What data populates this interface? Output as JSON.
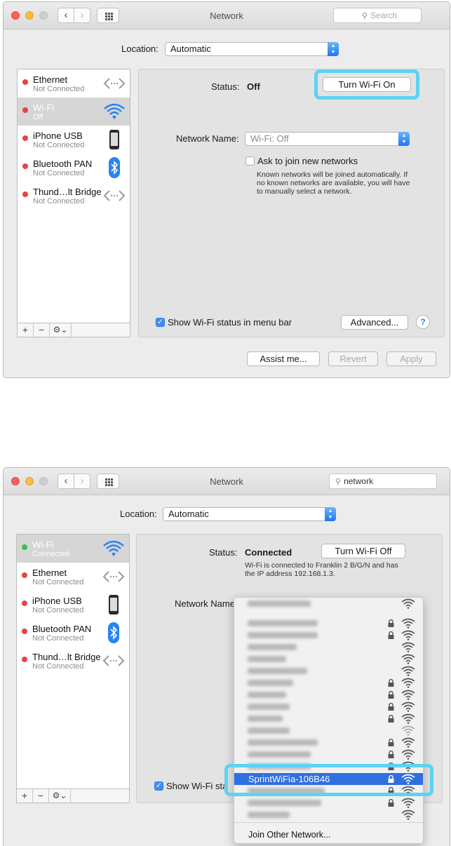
{
  "colors": {
    "accent": "#2f6fe0",
    "highlight": "#5dd3f3",
    "status_red": "#e2463f",
    "status_green": "#34c24b"
  },
  "window1": {
    "title": "Network",
    "search_placeholder": "Search",
    "location_label": "Location:",
    "location_value": "Automatic",
    "sidebar": [
      {
        "name": "Ethernet",
        "status": "Not Connected",
        "icon": "ethernet-icon",
        "dot": "red"
      },
      {
        "name": "Wi-Fi",
        "status": "Off",
        "icon": "wifi-icon",
        "dot": "red",
        "selected": true
      },
      {
        "name": "iPhone USB",
        "status": "Not Connected",
        "icon": "iphone-icon",
        "dot": "red"
      },
      {
        "name": "Bluetooth PAN",
        "status": "Not Connected",
        "icon": "bluetooth-icon",
        "dot": "red"
      },
      {
        "name": "Thund…lt Bridge",
        "status": "Not Connected",
        "icon": "thunderbolt-bridge-icon",
        "dot": "red"
      }
    ],
    "sidebar_footer": {
      "add": "+",
      "remove": "−",
      "gear": "⚙︎⌄"
    },
    "status_label": "Status:",
    "status_value": "Off",
    "turn_button": "Turn Wi-Fi On",
    "network_name_label": "Network Name:",
    "network_name_value": "Wi-Fi: Off",
    "ask_join_label": "Ask to join new networks",
    "ask_join_desc": "Known networks will be joined automatically. If no known networks are available, you will have to manually select a network.",
    "show_status_label": "Show Wi-Fi status in menu bar",
    "advanced_button": "Advanced...",
    "help": "?",
    "assist_button": "Assist me...",
    "revert_button": "Revert",
    "apply_button": "Apply"
  },
  "window2": {
    "title": "Network",
    "search_value": "network",
    "location_label": "Location:",
    "location_value": "Automatic",
    "sidebar": [
      {
        "name": "Wi-Fi",
        "status": "Connected",
        "icon": "wifi-icon",
        "dot": "green",
        "selected": true
      },
      {
        "name": "Ethernet",
        "status": "Not Connected",
        "icon": "ethernet-icon",
        "dot": "red"
      },
      {
        "name": "iPhone USB",
        "status": "Not Connected",
        "icon": "iphone-icon",
        "dot": "red"
      },
      {
        "name": "Bluetooth PAN",
        "status": "Not Connected",
        "icon": "bluetooth-icon",
        "dot": "red"
      },
      {
        "name": "Thund…lt Bridge",
        "status": "Not Connected",
        "icon": "thunderbolt-bridge-icon",
        "dot": "red"
      }
    ],
    "sidebar_footer": {
      "add": "+",
      "remove": "−",
      "gear": "⚙︎⌄"
    },
    "status_label": "Status:",
    "status_value": "Connected",
    "turn_button": "Turn Wi-Fi Off",
    "status_desc": "Wi-Fi is connected to Franklin 2 B/G/N and has the IP address 192.168.1.3.",
    "network_name_label": "Network Name",
    "show_status_label": "Show Wi-Fi sta",
    "dropdown": {
      "selected_network": "SprintWiFia-106B46",
      "join_other": "Join Other Network..."
    }
  }
}
